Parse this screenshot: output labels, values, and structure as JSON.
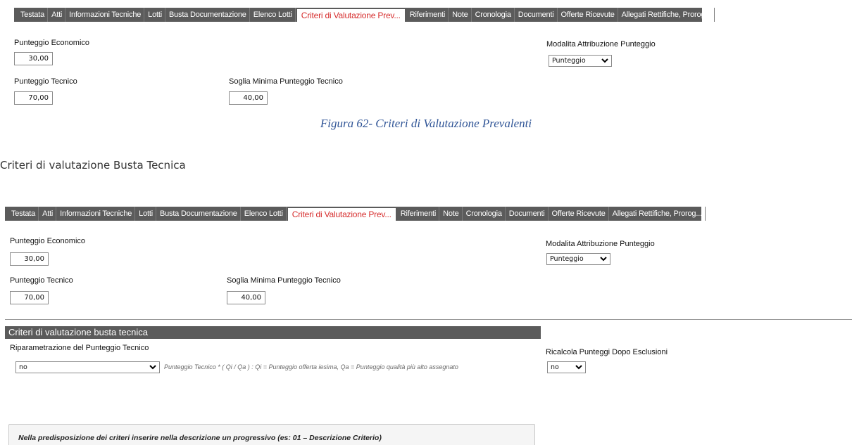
{
  "tabs": [
    {
      "label": "Testata"
    },
    {
      "label": "Atti"
    },
    {
      "label": "Informazioni Tecniche"
    },
    {
      "label": "Lotti"
    },
    {
      "label": "Busta Documentazione"
    },
    {
      "label": "Elenco Lotti"
    },
    {
      "label": "Criteri di Valutazione Prev...",
      "active": true
    },
    {
      "label": "Riferimenti"
    },
    {
      "label": "Note"
    },
    {
      "label": "Cronologia"
    },
    {
      "label": "Documenti"
    },
    {
      "label": "Offerte Ricevute"
    },
    {
      "label": "Allegati Rettifiche, Prorog..."
    }
  ],
  "panel1": {
    "punteggio_economico_label": "Punteggio Economico",
    "punteggio_economico_value": "30,00",
    "modalita_label": "Modalita Attribuzione Punteggio",
    "modalita_value": "Punteggio",
    "punteggio_tecnico_label": "Punteggio Tecnico",
    "punteggio_tecnico_value": "70,00",
    "soglia_label": "Soglia Minima Punteggio Tecnico",
    "soglia_value": "40,00"
  },
  "caption": "Figura 62- Criteri di Valutazione Prevalenti",
  "heading": "Criteri di valutazione Busta Tecnica",
  "panel2": {
    "punteggio_economico_label": "Punteggio Economico",
    "punteggio_economico_value": "30,00",
    "modalita_label": "Modalita Attribuzione Punteggio",
    "modalita_value": "Punteggio",
    "punteggio_tecnico_label": "Punteggio Tecnico",
    "punteggio_tecnico_value": "70,00",
    "soglia_label": "Soglia Minima Punteggio Tecnico",
    "soglia_value": "40,00",
    "section_title": "Criteri di valutazione busta tecnica",
    "riparametrazione_label": "Riparametrazione del Punteggio Tecnico",
    "riparametrazione_value": "no",
    "formula_hint": "Punteggio Tecnico * ( Qi / Qa ) : Qi = Punteggio offerta iesima, Qa = Punteggio qualità più alto assegnato",
    "ricalcola_label": "Ricalcola Punteggi Dopo Esclusioni",
    "ricalcola_value": "no",
    "note": "Nella predisposizione dei criteri inserire nella descrizione un progressivo (es: 01 – Descrizione Criterio)"
  },
  "colors": {
    "tabbar_bg": "#5b5b5b",
    "active_tab_text": "#d62d2d",
    "caption_text": "#2f5496"
  }
}
